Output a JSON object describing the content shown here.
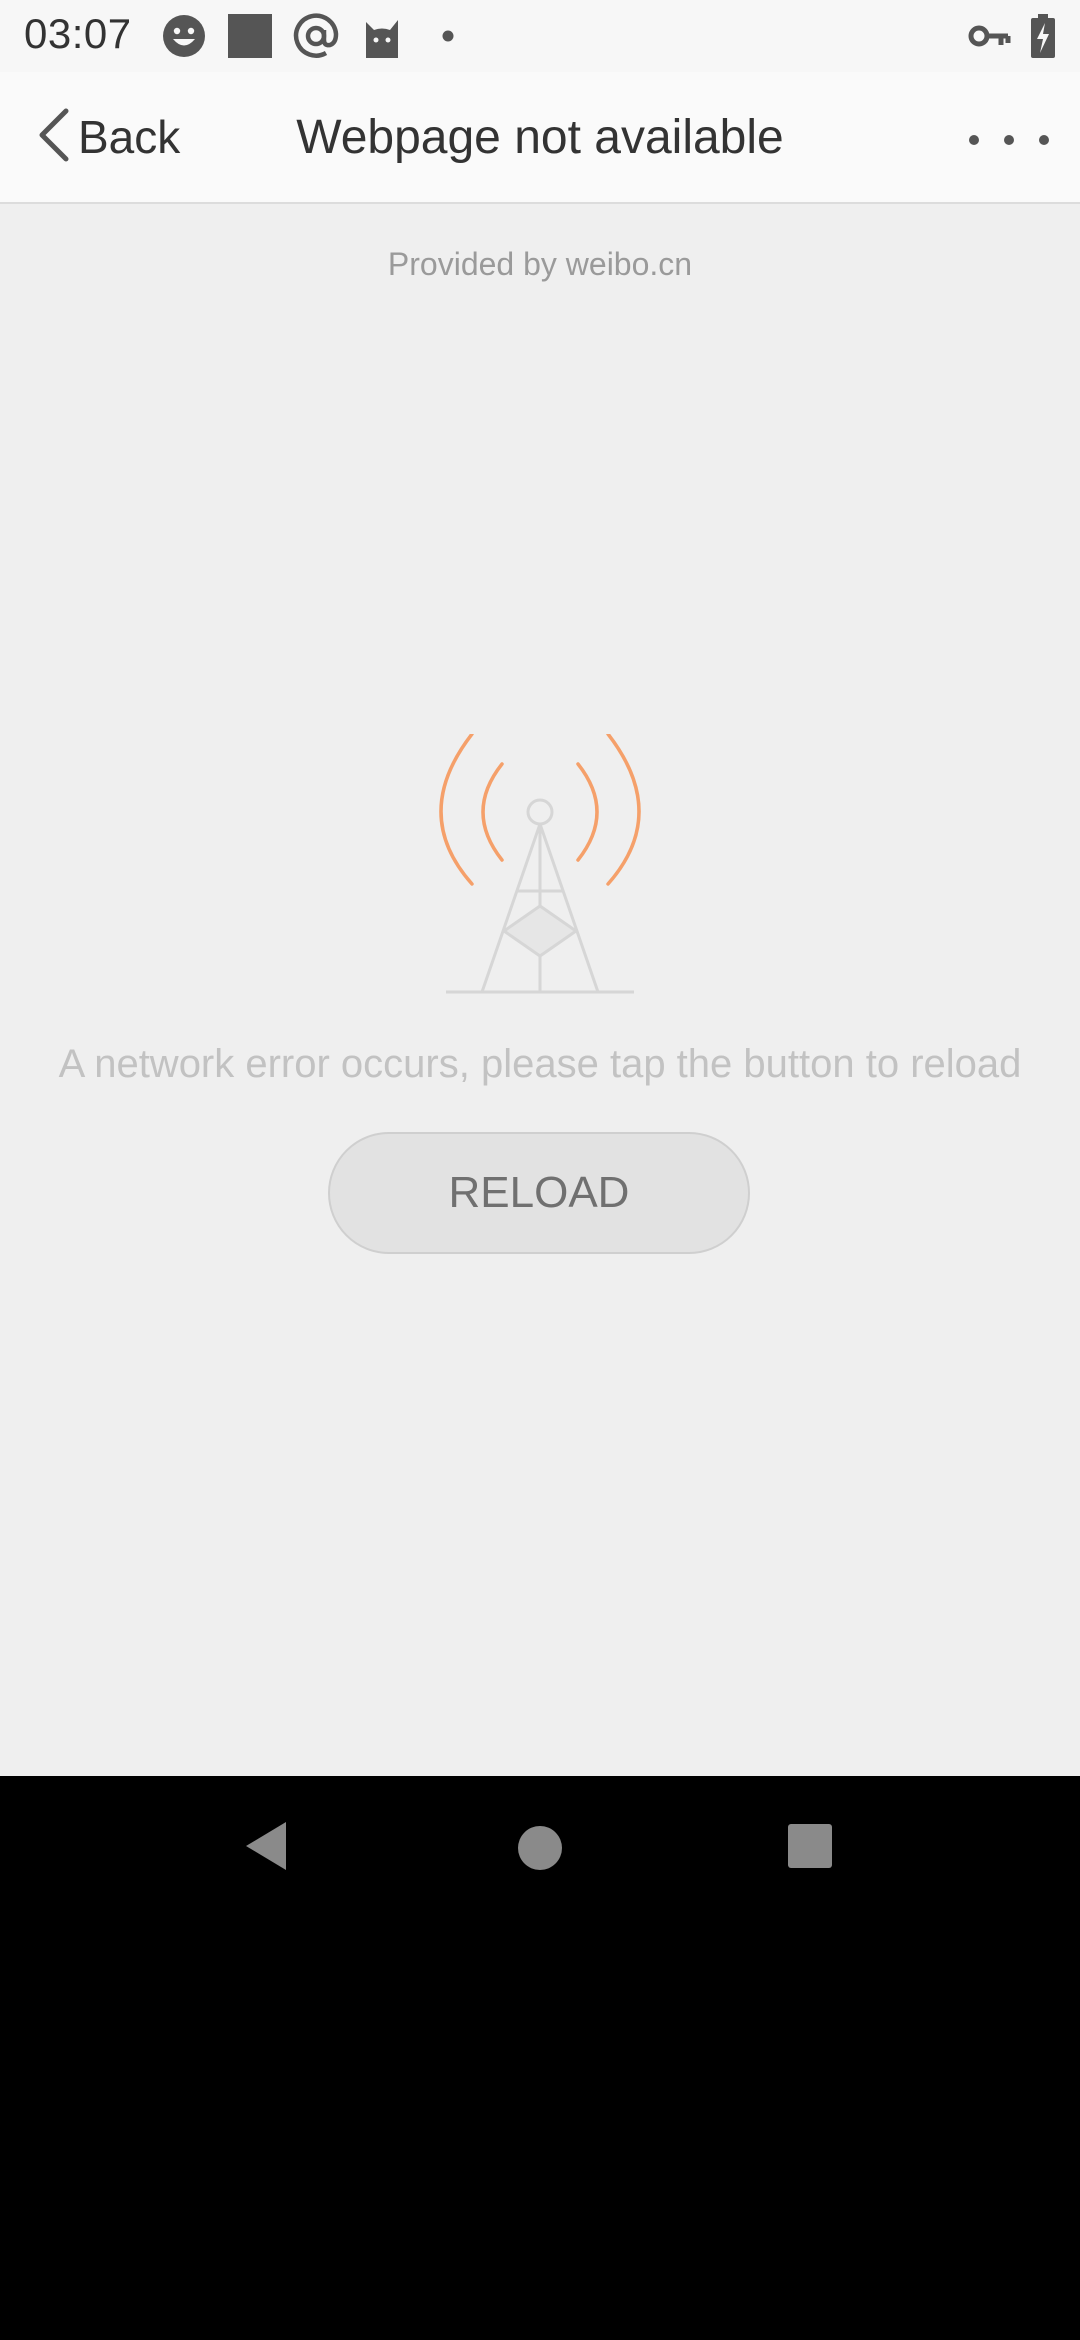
{
  "status_bar": {
    "time": "03:07",
    "icons": [
      "smiley-icon",
      "square-app-icon",
      "at-sign-icon",
      "cat-icon",
      "dot-icon",
      "vpn-key-icon",
      "battery-charging-icon"
    ]
  },
  "app_bar": {
    "back_label": "Back",
    "title": "Webpage not available",
    "more_icon": "more-horizontal-icon"
  },
  "content": {
    "provided_by": "Provided by weibo.cn",
    "illustration_icon": "signal-tower-icon",
    "error_message": "A network error occurs, please tap the button to reload",
    "reload_label": "RELOAD"
  },
  "nav_bar": {
    "icons": [
      "back-triangle-icon",
      "home-circle-icon",
      "recents-square-icon"
    ]
  },
  "colors": {
    "accent": "#f5a06a",
    "background": "#efefef",
    "text_primary": "#333333",
    "text_muted": "#c2c2c2"
  }
}
